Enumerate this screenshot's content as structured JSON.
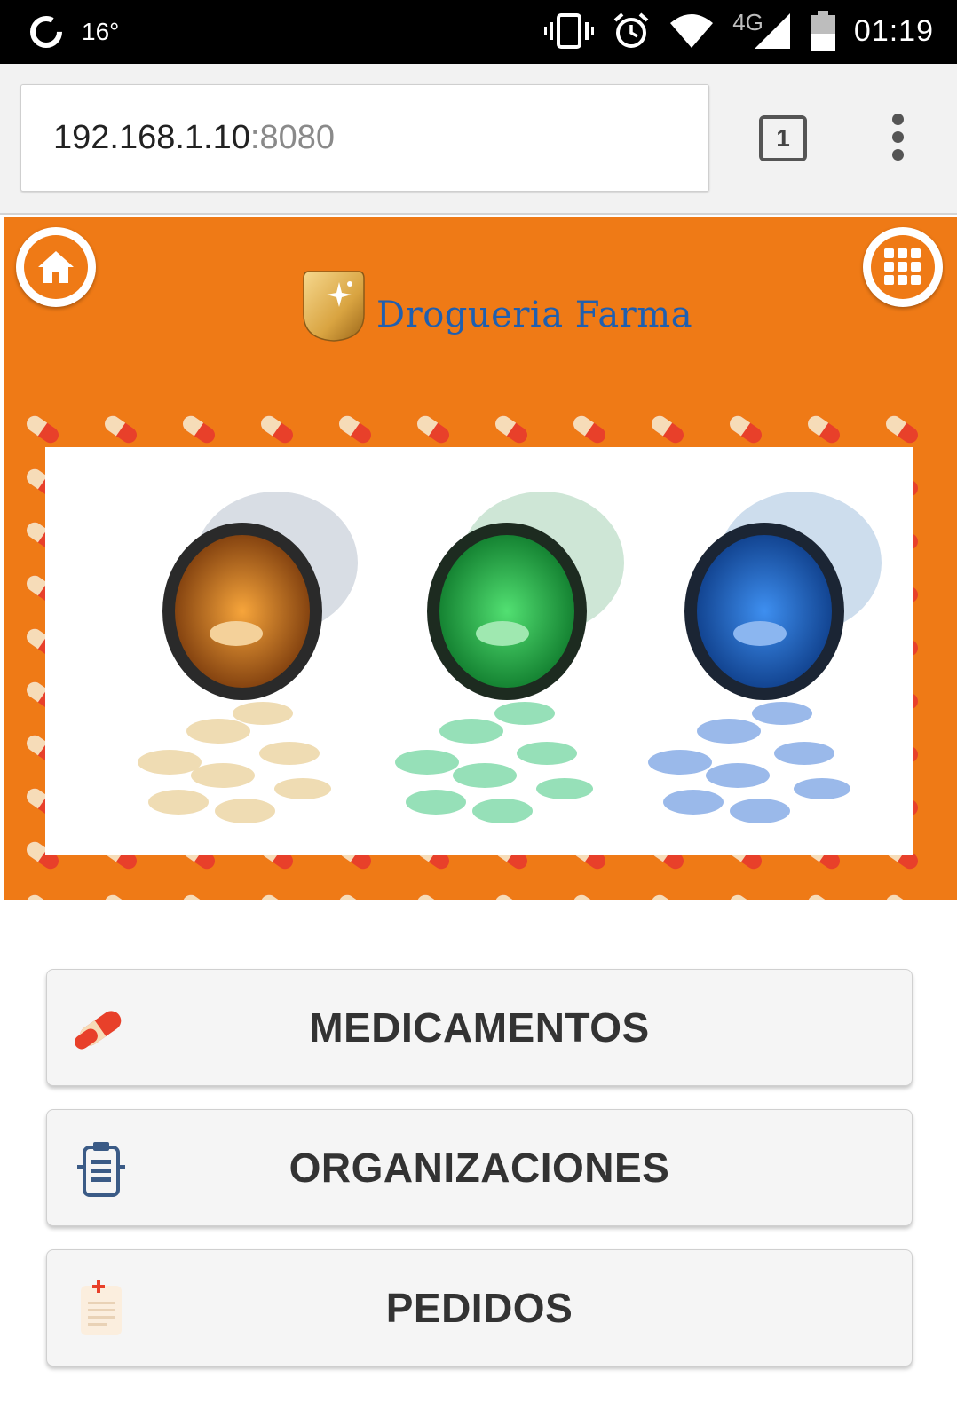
{
  "status_bar": {
    "temperature": "16°",
    "network": "4G",
    "time": "01:19",
    "icons": [
      "sync-icon",
      "vibrate-icon",
      "alarm-icon",
      "wifi-icon",
      "signal-icon",
      "battery-icon"
    ]
  },
  "browser": {
    "url_host": "192.168.1.10",
    "url_port": ":8080",
    "tab_count": "1"
  },
  "header": {
    "brand": "Drogueria Farma",
    "home_icon": "home-icon",
    "apps_icon": "grid-menu-icon",
    "background_color": "#ef7a16",
    "brand_color": "#1f5fb0"
  },
  "menu": {
    "items": [
      {
        "label": "MEDICAMENTOS",
        "icon": "pill-icon"
      },
      {
        "label": "ORGANIZACIONES",
        "icon": "building-icon"
      },
      {
        "label": "PEDIDOS",
        "icon": "order-clipboard-icon"
      }
    ]
  }
}
